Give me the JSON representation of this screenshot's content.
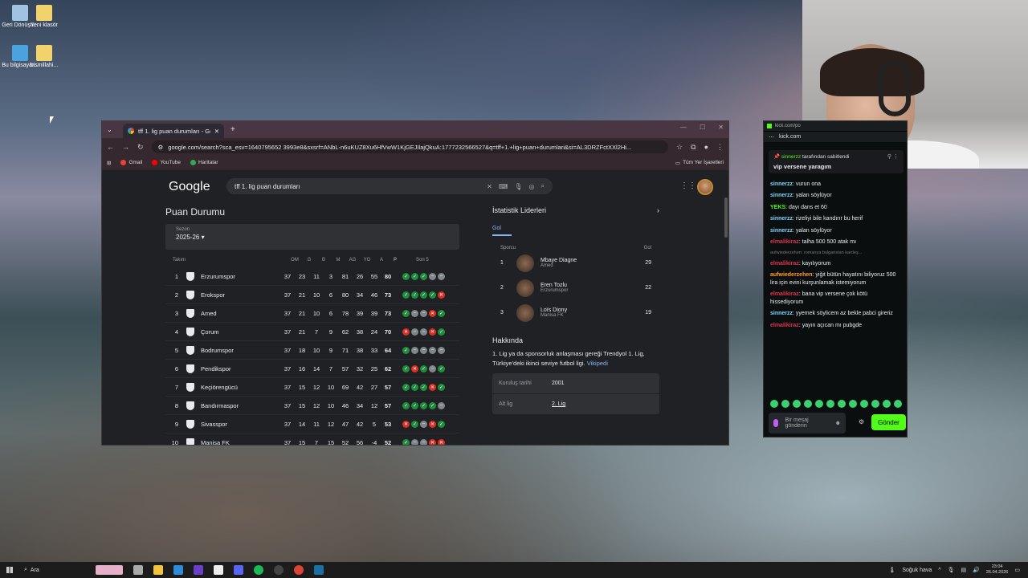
{
  "desktop": {
    "icons": [
      {
        "label": "Geri Dönüşü..."
      },
      {
        "label": "Yeni klasör"
      },
      {
        "label": "Bu bilgisayar..."
      },
      {
        "label": "bismillahi..."
      }
    ]
  },
  "browser": {
    "tab_title": "tff 1. lig puan durumları - Goog",
    "url": "google.com/search?sca_esv=1640795652 3993e8&sxsrf=ANbL-n6uKUZ8Xu6HfVwW1KjGEJIlajQkuA:1777232566527&q=tff+1.+lig+puan+durumlari&si=AL3DRZFctXXl2Hi...",
    "bookmarks": [
      "Gmail",
      "YouTube",
      "Haritalar"
    ],
    "bookmarks_right": "Tüm Yer İşaretleri",
    "google_logo": "Google",
    "search_query": "tff 1. lig puan durumları"
  },
  "standings": {
    "title": "Puan Durumu",
    "season_label": "Sezon",
    "season_value": "2025-26",
    "headers": {
      "team": "Takım",
      "om": "OM",
      "g": "G",
      "b": "B",
      "m": "M",
      "ag": "AG",
      "yg": "YG",
      "a": "A",
      "p": "P",
      "form": "Son 5"
    },
    "rows": [
      {
        "pos": "1",
        "name": "Erzurumspor",
        "om": "37",
        "g": "23",
        "b": "11",
        "m": "3",
        "ag": "81",
        "yg": "26",
        "a": "55",
        "p": "80",
        "form": [
          "W",
          "W",
          "W",
          "D",
          "D"
        ]
      },
      {
        "pos": "2",
        "name": "Erokspor",
        "om": "37",
        "g": "21",
        "b": "10",
        "m": "6",
        "ag": "80",
        "yg": "34",
        "a": "46",
        "p": "73",
        "form": [
          "W",
          "W",
          "W",
          "W",
          "L"
        ]
      },
      {
        "pos": "3",
        "name": "Amed",
        "om": "37",
        "g": "21",
        "b": "10",
        "m": "6",
        "ag": "78",
        "yg": "39",
        "a": "39",
        "p": "73",
        "form": [
          "W",
          "D",
          "D",
          "L",
          "W"
        ]
      },
      {
        "pos": "4",
        "name": "Çorum",
        "om": "37",
        "g": "21",
        "b": "7",
        "m": "9",
        "ag": "62",
        "yg": "38",
        "a": "24",
        "p": "70",
        "form": [
          "L",
          "D",
          "D",
          "L",
          "W"
        ]
      },
      {
        "pos": "5",
        "name": "Bodrumspor",
        "om": "37",
        "g": "18",
        "b": "10",
        "m": "9",
        "ag": "71",
        "yg": "38",
        "a": "33",
        "p": "64",
        "form": [
          "W",
          "D",
          "D",
          "D",
          "D"
        ]
      },
      {
        "pos": "6",
        "name": "Pendikspor",
        "om": "37",
        "g": "16",
        "b": "14",
        "m": "7",
        "ag": "57",
        "yg": "32",
        "a": "25",
        "p": "62",
        "form": [
          "W",
          "L",
          "W",
          "D",
          "W"
        ]
      },
      {
        "pos": "7",
        "name": "Keçiörengücü",
        "om": "37",
        "g": "15",
        "b": "12",
        "m": "10",
        "ag": "69",
        "yg": "42",
        "a": "27",
        "p": "57",
        "form": [
          "W",
          "W",
          "W",
          "L",
          "W"
        ]
      },
      {
        "pos": "8",
        "name": "Bandırmaspor",
        "om": "37",
        "g": "15",
        "b": "12",
        "m": "10",
        "ag": "46",
        "yg": "34",
        "a": "12",
        "p": "57",
        "form": [
          "W",
          "W",
          "W",
          "W",
          "D"
        ]
      },
      {
        "pos": "9",
        "name": "Sivasspor",
        "om": "37",
        "g": "14",
        "b": "11",
        "m": "12",
        "ag": "47",
        "yg": "42",
        "a": "5",
        "p": "53",
        "form": [
          "L",
          "W",
          "D",
          "L",
          "W"
        ]
      },
      {
        "pos": "10",
        "name": "Manisa FK",
        "om": "37",
        "g": "15",
        "b": "7",
        "m": "15",
        "ag": "52",
        "yg": "56",
        "a": "-4",
        "p": "52",
        "form": [
          "W",
          "D",
          "D",
          "L",
          "L"
        ]
      }
    ]
  },
  "stats": {
    "title": "İstatistik Liderleri",
    "tab": "Gol",
    "player_header": "Sporcu",
    "goal_header": "Gol",
    "players": [
      {
        "rank": "1",
        "name": "Mbaye Diagne",
        "team": "Amed",
        "goals": "29"
      },
      {
        "rank": "2",
        "name": "Eren Tozlu",
        "team": "Erzurumspor",
        "goals": "22"
      },
      {
        "rank": "3",
        "name": "Loïs Diony",
        "team": "Manisa FK",
        "goals": "19"
      }
    ],
    "about_title": "Hakkında",
    "about_text": "1. Lig ya da sponsorluk anlaşması gereği Trendyol 1. Lig, Türkiye'deki ikinci seviye futbol ligi.",
    "about_link": "Vikipedi",
    "info": [
      {
        "k": "Kuruluş tarihi",
        "v": "2001"
      },
      {
        "k": "Alt lig",
        "v": "2. Lig"
      }
    ]
  },
  "chat": {
    "tab": "kick.com/po",
    "url": "kick.com",
    "pinned_by_user": "sinnerzz",
    "pinned_by_text": "tarafından sabitlendi",
    "pinned_msg": "vip versene yaragım",
    "messages": [
      {
        "user": "sinnerzz",
        "text": "vurun ona",
        "color": "#7fd4ff"
      },
      {
        "user": "sinnerzz",
        "text": "yalan söylüyor",
        "color": "#7fd4ff"
      },
      {
        "user": "YEKS",
        "text": "dayı dans et 60",
        "color": "#53fc18"
      },
      {
        "user": "sinnerzz",
        "text": "rizeliyi bile kandırır bu herif",
        "color": "#7fd4ff"
      },
      {
        "user": "sinnerzz",
        "text": "yalan söylüyor",
        "color": "#7fd4ff"
      },
      {
        "user": "elmalikiraz",
        "text": "talha 500 500 atak mı",
        "color": "#e0344c"
      },
      {
        "user": "elmalikiraz",
        "text": "kayılıyorum",
        "color": "#e0344c"
      },
      {
        "user": "aufwiederzehen",
        "text": "yiğit bütün hayatını biliyoruz 500 lira için evini kurşunlamak istemiyorum",
        "color": "#ff9f2e"
      },
      {
        "user": "elmalikiraz",
        "text": "bana vip versene çok kötü hissediyorum",
        "color": "#e0344c"
      },
      {
        "user": "sinnerzz",
        "text": "yyemek söylicem az bekle pabci gireriz",
        "color": "#7fd4ff"
      },
      {
        "user": "elmalikiraz",
        "text": "yayın açıcan mı pubgde",
        "color": "#e0344c"
      }
    ],
    "sys_msg": "aufwiederzehen: romanya bulgaristan kardeş...",
    "input_placeholder": "Bir mesaj gönderin",
    "send_label": "Gönder"
  },
  "taskbar": {
    "search": "Ara",
    "weather": "Soğuk hava",
    "time": "23:04",
    "date": "26.04.2026"
  }
}
